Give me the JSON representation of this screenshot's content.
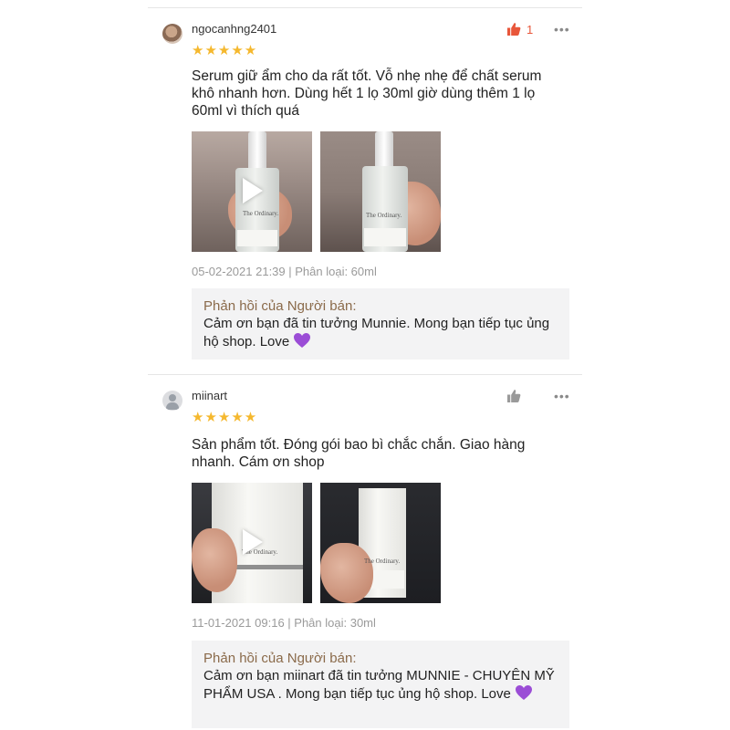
{
  "reviews": [
    {
      "username": "ngocanhng2401",
      "stars": "★★★★★",
      "like_count": "1",
      "liked": true,
      "text": "Serum giữ ẩm cho da rất tốt. Vỗ nhẹ nhẹ để chất serum khô nhanh hơn. Dùng hết 1 lọ 30ml giờ dùng thêm 1 lọ 60ml vì thích quá",
      "meta": "05-02-2021 21:39 | Phân loại: 60ml",
      "reply_title": "Phản hồi của Người bán:",
      "reply_text": "Cảm ơn bạn đã tin tưởng Munnie. Mong bạn tiếp tục ủng hộ shop. Love",
      "media_brand": [
        "The Ordinary.",
        "The Ordinary."
      ]
    },
    {
      "username": "miinart",
      "stars": "★★★★★",
      "like_count": "",
      "liked": false,
      "text": "Sản phẩm tốt. Đóng gói bao bì chắc chắn. Giao hàng nhanh. Cám ơn shop",
      "meta": "11-01-2021 09:16 | Phân loại: 30ml",
      "reply_title": "Phản hồi của Người bán:",
      "reply_text": "Cảm ơn bạn  miinart  đã tin tưởng  MUNNIE - CHUYÊN MỸ PHẨM USA . Mong bạn tiếp tục ủng hộ shop. Love",
      "media_brand": [
        "The Ordinary.",
        "The Ordinary."
      ]
    }
  ],
  "icons": {
    "like": "thumbs-up-icon",
    "more": "more-dots-icon",
    "play": "play-icon",
    "heart": "purple-heart-icon"
  },
  "colors": {
    "star": "#f5b82e",
    "like_active": "#e8563a",
    "like_inactive": "#9a9a9a",
    "reply_title": "#8a6a4a",
    "reply_bg": "#f3f3f4",
    "meta": "#9a9a9a",
    "heart": "#9b4dd6"
  }
}
